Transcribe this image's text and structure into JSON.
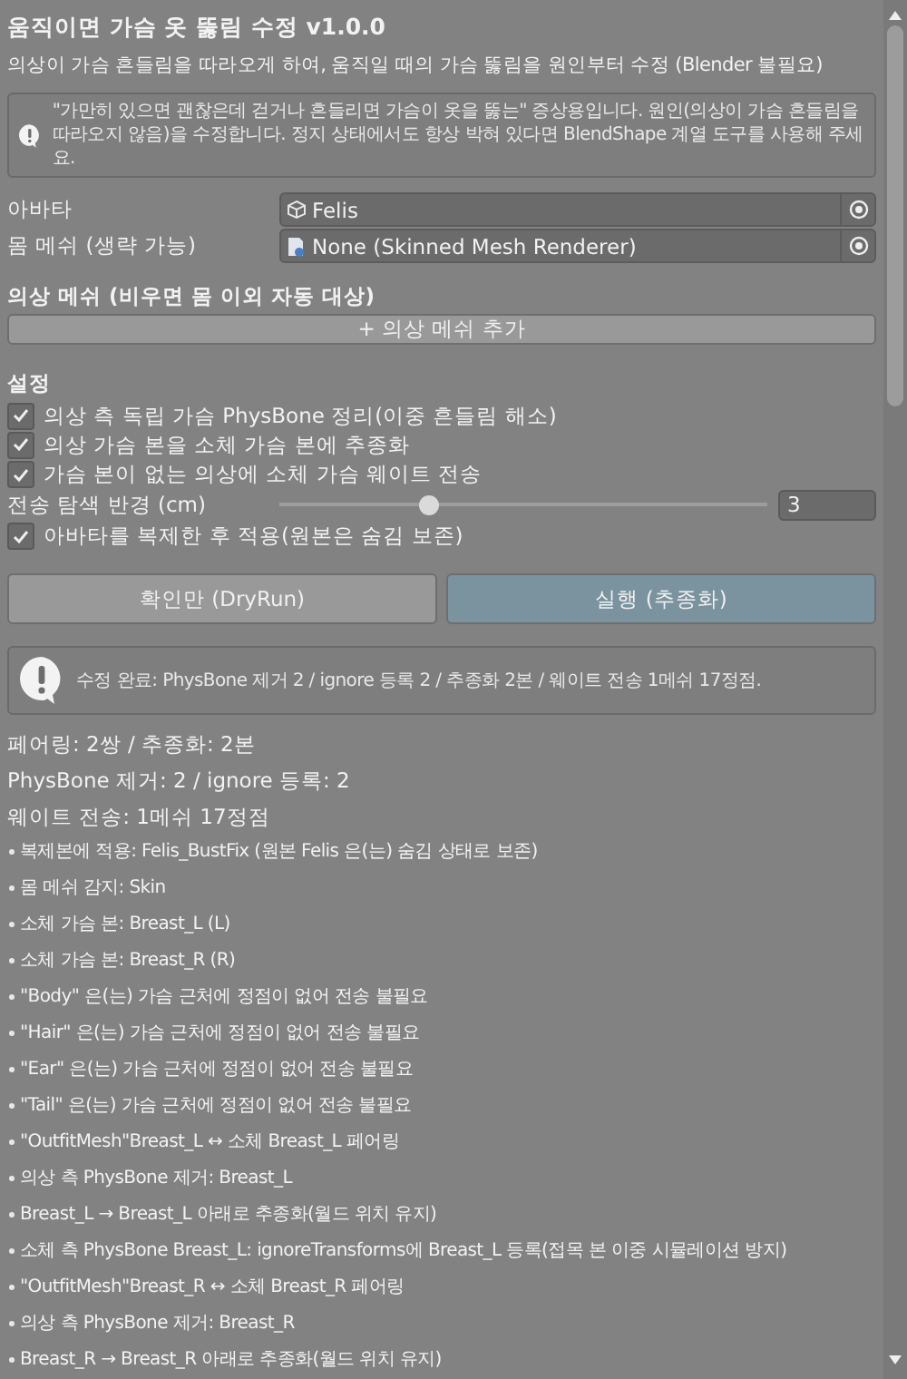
{
  "title": "움직이면 가슴 옷 뚫림 수정 v1.0.0",
  "subtitle": "의상이 가슴 흔들림을 따라오게 하여, 움직일 때의 가슴 뚫림을 원인부터 수정 (Blender 불필요)",
  "notice": "\"가만히 있으면 괜찮은데 걷거나 흔들리면 가슴이 옷을 뚫는\" 증상용입니다. 원인(의상이 가슴 흔들림을 따라오지 않음)을 수정합니다. 정지 상태에서도 항상 박혀 있다면 BlendShape 계열 도구를 사용해 주세요.",
  "fields": [
    {
      "label": "아바타",
      "value": "Felis",
      "kind": "object"
    },
    {
      "label": "몸 메쉬 (생략 가능)",
      "value": "None (Skinned Mesh Renderer)",
      "kind": "mesh"
    }
  ],
  "outfit": {
    "title": "의상 메쉬 (비우면 몸 이외 자동 대상)",
    "add_button": "+ 의상 메쉬 추가"
  },
  "settings": {
    "title": "설정",
    "items": [
      {
        "kind": "checkbox",
        "label": "의상 측 독립 가슴 PhysBone 정리(이중 흔들림 해소)",
        "checked": true
      },
      {
        "kind": "checkbox",
        "label": "의상 가슴 본을 소체 가슴 본에 추종화",
        "checked": true
      },
      {
        "kind": "checkbox",
        "label": "가슴 본이 없는 의상에 소체 가슴 웨이트 전송",
        "checked": true
      },
      {
        "kind": "slider",
        "label": "전송 탐색 반경 (cm)",
        "level": 0.3,
        "value": "3"
      },
      {
        "kind": "checkbox",
        "label": "아바타를 복제한 후 적용(원본은 숨김 보존)",
        "checked": true
      }
    ]
  },
  "actions": [
    {
      "label": "확인만 (DryRun)",
      "highlighted": false
    },
    {
      "label": "실행 (추종화)",
      "highlighted": true
    }
  ],
  "result": "수정 완료: PhysBone 제거 2 / ignore 등록 2 / 추종화 2본 / 웨이트 전송 1메쉬 17정점.",
  "stats": [
    "페어링: 2쌍 / 추종화: 2본",
    "PhysBone 제거: 2 / ignore 등록: 2",
    "웨이트 전송: 1메쉬 17정점"
  ],
  "log": [
    "복제본에 적용: Felis_BustFix (원본 Felis 은(는) 숨김 상태로 보존)",
    "몸 메쉬 감지: Skin",
    "소체 가슴 본: Breast_L (L)",
    "소체 가슴 본: Breast_R (R)",
    "\"Body\" 은(는) 가슴 근처에 정점이 없어 전송 불필요",
    "\"Hair\" 은(는) 가슴 근처에 정점이 없어 전송 불필요",
    "\"Ear\" 은(는) 가슴 근처에 정점이 없어 전송 불필요",
    "\"Tail\" 은(는) 가슴 근처에 정점이 없어 전송 불필요",
    "\"OutfitMesh\"Breast_L ↔ 소체 Breast_L 페어링",
    "의상 측 PhysBone 제거: Breast_L",
    "Breast_L → Breast_L 아래로 추종화(월드 위치 유지)",
    "소체 측 PhysBone Breast_L: ignoreTransforms에 Breast_L 등록(접목 본 이중 시뮬레이션 방지)",
    "\"OutfitMesh\"Breast_R ↔ 소체 Breast_R 페어링",
    "의상 측 PhysBone 제거: Breast_R",
    "Breast_R → Breast_R 아래로 추종화(월드 위치 유지)"
  ]
}
